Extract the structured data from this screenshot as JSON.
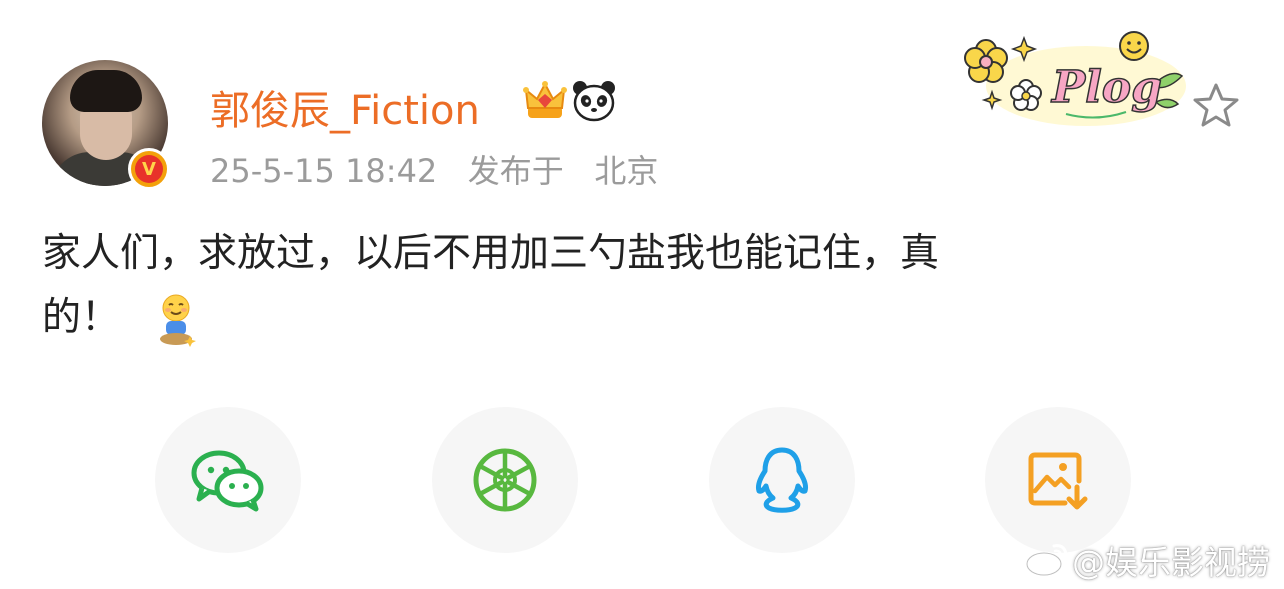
{
  "post": {
    "username": "郭俊辰_Fiction",
    "timestamp": "25-5-15 18:42",
    "published_at_label": "发布于",
    "location": "北京",
    "content_line1": "家人们，求放过，以后不用加三勺盐我也能记住，真",
    "content_line2": "的！",
    "emoji": "smiling-sitting-emoji"
  },
  "badges": {
    "verified": "V",
    "icons": [
      "crown-icon",
      "panda-icon"
    ]
  },
  "sticker": {
    "text": "Plog"
  },
  "share": {
    "buttons": [
      {
        "icon": "wechat-icon",
        "color": "#2bb04f"
      },
      {
        "icon": "moments-icon",
        "color": "#58b83f"
      },
      {
        "icon": "qq-icon",
        "color": "#1fa0e8"
      },
      {
        "icon": "save-image-icon",
        "color": "#f4a023"
      }
    ]
  },
  "watermark": {
    "text": "@娱乐影视捞"
  },
  "colors": {
    "username": "#ec6d26",
    "meta": "#9b9b9b",
    "text": "#222222",
    "share_bg": "#f6f6f6"
  }
}
